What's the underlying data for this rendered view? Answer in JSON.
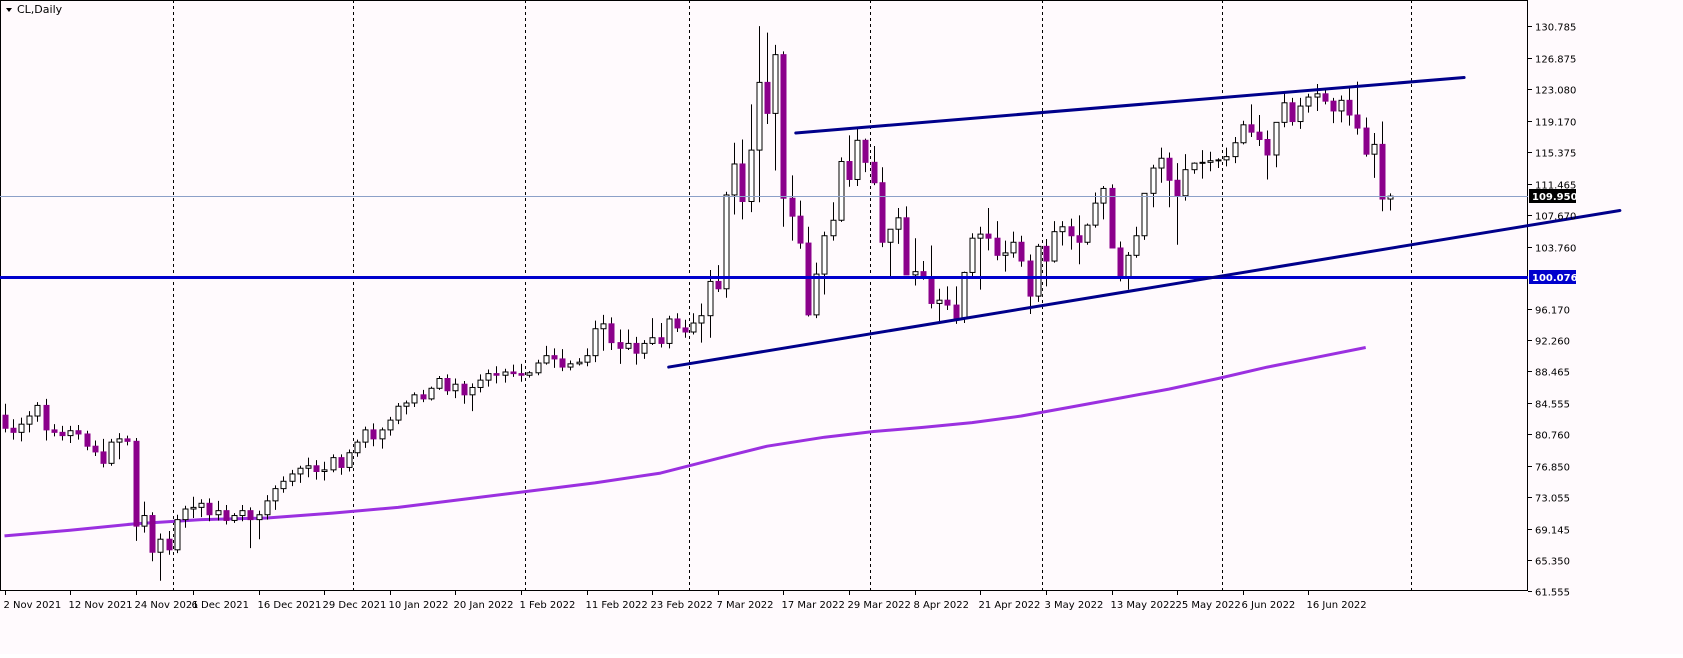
{
  "window": {
    "title": "CL,Daily"
  },
  "colors": {
    "background": "#fffafd",
    "grid": "#000000",
    "bull_body": "#ffffff",
    "bull_border": "#000000",
    "bear_body": "#8b008b",
    "wick": "#000000",
    "ma_line": "#9b30e0",
    "hline": "#0000cd",
    "channel": "#00008b",
    "price_marker_bg": "#000000",
    "price_marker_fg": "#ffffff",
    "hline_marker_bg": "#0000cd"
  },
  "chart_data": {
    "type": "candlestick",
    "symbol": "CL,Daily",
    "y_axis": {
      "min": 61.55,
      "max": 134.0,
      "ticks": [
        130.785,
        126.875,
        123.08,
        119.17,
        115.375,
        111.465,
        107.67,
        103.76,
        96.17,
        92.26,
        88.465,
        84.555,
        80.76,
        76.85,
        73.055,
        69.145,
        65.35,
        61.555
      ]
    },
    "x_axis": {
      "labels": [
        {
          "text": "2 Nov 2021",
          "index": 0
        },
        {
          "text": "12 Nov 2021",
          "index": 8
        },
        {
          "text": "24 Nov 2021",
          "index": 16
        },
        {
          "text": "6 Dec 2021",
          "index": 23
        },
        {
          "text": "16 Dec 2021",
          "index": 31
        },
        {
          "text": "29 Dec 2021",
          "index": 39
        },
        {
          "text": "10 Jan 2022",
          "index": 47
        },
        {
          "text": "20 Jan 2022",
          "index": 55
        },
        {
          "text": "1 Feb 2022",
          "index": 63
        },
        {
          "text": "11 Feb 2022",
          "index": 71
        },
        {
          "text": "23 Feb 2022",
          "index": 79
        },
        {
          "text": "7 Mar 2022",
          "index": 87
        },
        {
          "text": "17 Mar 2022",
          "index": 95
        },
        {
          "text": "29 Mar 2022",
          "index": 103
        },
        {
          "text": "8 Apr 2022",
          "index": 111
        },
        {
          "text": "21 Apr 2022",
          "index": 119
        },
        {
          "text": "3 May 2022",
          "index": 127
        },
        {
          "text": "13 May 2022",
          "index": 135
        },
        {
          "text": "25 May 2022",
          "index": 143
        },
        {
          "text": "6 Jun 2022",
          "index": 151
        },
        {
          "text": "16 Jun 2022",
          "index": 159
        }
      ],
      "separator_indices": [
        20.5,
        42.5,
        63.5,
        83.5,
        105.5,
        126.5,
        148.5,
        171.5
      ]
    },
    "candles": [
      [
        83.1,
        84.5,
        81.0,
        81.5
      ],
      [
        81.5,
        82.6,
        80.1,
        81.0
      ],
      [
        81.0,
        82.8,
        79.9,
        82.0
      ],
      [
        82.0,
        83.6,
        81.0,
        83.0
      ],
      [
        83.0,
        84.7,
        82.3,
        84.3
      ],
      [
        84.3,
        85.1,
        80.0,
        81.3
      ],
      [
        81.3,
        82.0,
        80.5,
        81.0
      ],
      [
        81.0,
        81.8,
        80.0,
        80.6
      ],
      [
        80.6,
        81.8,
        79.7,
        81.2
      ],
      [
        81.2,
        81.9,
        80.1,
        80.8
      ],
      [
        80.8,
        81.2,
        78.8,
        79.3
      ],
      [
        79.3,
        80.0,
        78.1,
        78.6
      ],
      [
        78.6,
        80.2,
        76.7,
        77.2
      ],
      [
        77.2,
        80.2,
        76.9,
        79.8
      ],
      [
        79.8,
        80.9,
        77.7,
        80.2
      ],
      [
        80.2,
        80.6,
        79.4,
        79.9
      ],
      [
        79.9,
        80.3,
        67.7,
        69.5
      ],
      [
        69.5,
        72.5,
        68.7,
        70.8
      ],
      [
        70.8,
        71.2,
        65.2,
        66.3
      ],
      [
        66.3,
        68.6,
        62.8,
        67.9
      ],
      [
        67.9,
        68.9,
        66.0,
        66.6
      ],
      [
        66.6,
        70.9,
        66.2,
        70.3
      ],
      [
        70.3,
        72.0,
        69.3,
        71.6
      ],
      [
        71.6,
        73.1,
        70.5,
        71.8
      ],
      [
        71.8,
        72.8,
        70.6,
        72.3
      ],
      [
        72.3,
        72.9,
        70.1,
        70.9
      ],
      [
        70.9,
        72.6,
        70.2,
        71.4
      ],
      [
        71.4,
        72.1,
        69.7,
        70.2
      ],
      [
        70.2,
        71.1,
        69.9,
        70.8
      ],
      [
        70.8,
        72.1,
        70.1,
        71.4
      ],
      [
        71.4,
        71.8,
        66.8,
        70.3
      ],
      [
        70.3,
        71.4,
        67.9,
        70.9
      ],
      [
        70.9,
        73.3,
        70.3,
        72.6
      ],
      [
        72.6,
        74.5,
        71.5,
        74.1
      ],
      [
        74.1,
        75.6,
        73.6,
        75.0
      ],
      [
        75.0,
        76.4,
        74.4,
        75.9
      ],
      [
        75.9,
        76.9,
        74.8,
        76.6
      ],
      [
        76.6,
        77.9,
        75.5,
        76.9
      ],
      [
        76.9,
        77.6,
        75.2,
        76.2
      ],
      [
        76.2,
        77.4,
        75.1,
        76.4
      ],
      [
        76.4,
        78.3,
        76.1,
        77.9
      ],
      [
        77.9,
        78.3,
        75.8,
        76.7
      ],
      [
        76.7,
        78.9,
        76.2,
        78.5
      ],
      [
        78.5,
        80.1,
        78.0,
        79.8
      ],
      [
        79.8,
        81.7,
        79.1,
        81.3
      ],
      [
        81.3,
        82.1,
        79.3,
        80.2
      ],
      [
        80.2,
        81.6,
        79.0,
        81.3
      ],
      [
        81.3,
        82.9,
        80.6,
        82.5
      ],
      [
        82.5,
        84.6,
        82.0,
        84.2
      ],
      [
        84.2,
        84.9,
        83.2,
        84.6
      ],
      [
        84.6,
        85.9,
        84.1,
        85.6
      ],
      [
        85.6,
        86.2,
        84.7,
        85.1
      ],
      [
        85.1,
        86.6,
        84.9,
        86.4
      ],
      [
        86.4,
        87.9,
        86.2,
        87.6
      ],
      [
        87.6,
        88.1,
        85.6,
        86.1
      ],
      [
        86.1,
        87.6,
        85.2,
        86.9
      ],
      [
        86.9,
        87.3,
        84.5,
        85.6
      ],
      [
        85.6,
        87.0,
        83.6,
        86.5
      ],
      [
        86.5,
        88.1,
        85.9,
        87.4
      ],
      [
        87.4,
        88.7,
        86.6,
        88.2
      ],
      [
        88.2,
        89.1,
        87.0,
        88.0
      ],
      [
        88.0,
        88.8,
        87.1,
        88.4
      ],
      [
        88.4,
        89.3,
        87.8,
        88.2
      ],
      [
        88.2,
        89.4,
        87.2,
        88.0
      ],
      [
        88.0,
        88.5,
        87.7,
        88.3
      ],
      [
        88.3,
        89.9,
        88.0,
        89.5
      ],
      [
        89.5,
        91.6,
        89.3,
        90.4
      ],
      [
        90.4,
        91.3,
        88.9,
        90.0
      ],
      [
        90.0,
        91.2,
        88.5,
        89.0
      ],
      [
        89.0,
        89.8,
        88.6,
        89.4
      ],
      [
        89.4,
        90.1,
        89.2,
        89.6
      ],
      [
        89.6,
        91.3,
        89.1,
        90.4
      ],
      [
        90.4,
        94.7,
        89.6,
        93.7
      ],
      [
        93.7,
        95.4,
        91.0,
        94.3
      ],
      [
        94.3,
        95.1,
        91.1,
        92.0
      ],
      [
        92.0,
        93.6,
        89.4,
        91.3
      ],
      [
        91.3,
        93.6,
        91.1,
        91.9
      ],
      [
        91.9,
        92.7,
        89.3,
        90.7
      ],
      [
        90.7,
        92.3,
        90.0,
        91.9
      ],
      [
        91.9,
        95.0,
        91.7,
        92.6
      ],
      [
        92.6,
        94.4,
        91.4,
        91.9
      ],
      [
        91.9,
        95.3,
        91.3,
        94.9
      ],
      [
        94.9,
        95.6,
        93.3,
        93.8
      ],
      [
        93.8,
        94.8,
        92.6,
        93.3
      ],
      [
        93.3,
        95.6,
        93.0,
        94.4
      ],
      [
        94.4,
        96.8,
        92.0,
        95.3
      ],
      [
        95.3,
        100.9,
        92.6,
        99.5
      ],
      [
        99.5,
        101.5,
        98.2,
        98.6
      ],
      [
        98.6,
        110.5,
        97.5,
        110.1
      ],
      [
        110.1,
        116.5,
        107.7,
        113.9
      ],
      [
        113.9,
        116.9,
        107.1,
        109.3
      ],
      [
        109.3,
        121.2,
        108.0,
        115.6
      ],
      [
        115.6,
        130.8,
        109.2,
        123.9
      ],
      [
        123.9,
        130.0,
        118.8,
        120.1
      ],
      [
        120.1,
        128.5,
        113.1,
        127.3
      ],
      [
        127.3,
        127.7,
        106.2,
        109.7
      ],
      [
        109.7,
        112.5,
        104.5,
        107.5
      ],
      [
        107.5,
        109.4,
        103.5,
        104.2
      ],
      [
        104.2,
        106.2,
        95.2,
        95.4
      ],
      [
        95.4,
        101.8,
        95.0,
        100.4
      ],
      [
        100.4,
        105.6,
        97.9,
        105.1
      ],
      [
        105.1,
        109.2,
        104.5,
        107.0
      ],
      [
        107.0,
        114.7,
        106.8,
        114.2
      ],
      [
        114.2,
        117.4,
        111.1,
        112.0
      ],
      [
        112.0,
        118.3,
        111.2,
        116.8
      ],
      [
        116.8,
        117.0,
        112.9,
        114.1
      ],
      [
        114.1,
        116.1,
        111.3,
        111.6
      ],
      [
        111.6,
        113.5,
        103.7,
        104.3
      ],
      [
        104.3,
        105.8,
        99.8,
        105.9
      ],
      [
        105.9,
        108.5,
        104.1,
        107.3
      ],
      [
        107.3,
        108.7,
        100.9,
        100.3
      ],
      [
        100.3,
        104.8,
        99.0,
        100.7
      ],
      [
        100.7,
        102.0,
        99.7,
        99.9
      ],
      [
        99.9,
        103.9,
        96.2,
        96.8
      ],
      [
        96.8,
        98.6,
        94.5,
        97.2
      ],
      [
        97.2,
        98.9,
        96.0,
        96.6
      ],
      [
        96.6,
        98.9,
        94.3,
        94.9
      ],
      [
        94.9,
        100.7,
        94.4,
        100.6
      ],
      [
        100.6,
        105.4,
        100.1,
        104.8
      ],
      [
        104.8,
        106.2,
        98.5,
        105.3
      ],
      [
        105.3,
        108.5,
        103.3,
        104.8
      ],
      [
        104.8,
        106.9,
        102.1,
        102.7
      ],
      [
        102.7,
        104.5,
        100.7,
        103.0
      ],
      [
        103.0,
        105.6,
        102.4,
        104.3
      ],
      [
        104.3,
        105.1,
        101.3,
        102.0
      ],
      [
        102.0,
        102.8,
        95.5,
        97.7
      ],
      [
        97.7,
        104.1,
        97.0,
        103.8
      ],
      [
        103.8,
        104.7,
        98.9,
        102.0
      ],
      [
        102.0,
        106.9,
        101.8,
        105.6
      ],
      [
        105.6,
        106.9,
        103.9,
        106.2
      ],
      [
        106.2,
        107.2,
        103.4,
        105.1
      ],
      [
        105.1,
        107.6,
        101.6,
        104.3
      ],
      [
        104.3,
        106.6,
        104.0,
        106.4
      ],
      [
        106.4,
        110.4,
        106.1,
        109.1
      ],
      [
        109.1,
        111.2,
        107.1,
        110.9
      ],
      [
        110.9,
        111.4,
        104.4,
        103.6
      ],
      [
        103.6,
        104.4,
        99.5,
        99.9
      ],
      [
        99.9,
        103.1,
        98.5,
        102.7
      ],
      [
        102.7,
        106.2,
        102.4,
        105.1
      ],
      [
        105.1,
        110.2,
        104.6,
        110.3
      ],
      [
        110.3,
        113.8,
        108.6,
        113.4
      ],
      [
        113.4,
        115.9,
        111.6,
        114.6
      ],
      [
        114.6,
        115.3,
        108.6,
        111.9
      ],
      [
        111.9,
        114.0,
        104.0,
        110.0
      ],
      [
        110.0,
        115.1,
        109.4,
        113.2
      ],
      [
        113.2,
        114.1,
        112.7,
        114.0
      ],
      [
        114.0,
        115.6,
        112.1,
        114.1
      ],
      [
        114.1,
        115.4,
        113.0,
        114.3
      ],
      [
        114.3,
        114.6,
        113.4,
        114.4
      ],
      [
        114.4,
        115.9,
        113.6,
        114.8
      ],
      [
        114.8,
        117.2,
        114.0,
        116.5
      ],
      [
        116.5,
        119.2,
        116.3,
        118.7
      ],
      [
        118.7,
        121.2,
        117.2,
        117.8
      ],
      [
        117.8,
        119.9,
        116.1,
        116.9
      ],
      [
        116.9,
        118.0,
        112.0,
        115.0
      ],
      [
        115.0,
        117.5,
        113.5,
        119.0
      ],
      [
        119.0,
        122.7,
        118.4,
        121.4
      ],
      [
        121.4,
        122.0,
        118.6,
        119.1
      ],
      [
        119.1,
        122.0,
        118.2,
        121.0
      ],
      [
        121.0,
        122.5,
        120.2,
        122.1
      ],
      [
        122.1,
        123.7,
        120.4,
        122.5
      ],
      [
        122.5,
        123.1,
        121.2,
        121.6
      ],
      [
        121.6,
        122.0,
        118.9,
        120.4
      ],
      [
        120.4,
        122.3,
        119.0,
        121.7
      ],
      [
        121.7,
        123.5,
        118.6,
        119.9
      ],
      [
        119.9,
        124.0,
        117.5,
        118.3
      ],
      [
        118.3,
        119.6,
        114.8,
        115.1
      ],
      [
        115.1,
        117.7,
        112.2,
        116.3
      ],
      [
        116.3,
        119.1,
        108.1,
        109.6
      ],
      [
        109.6,
        110.3,
        108.2,
        109.95
      ]
    ],
    "moving_average": {
      "label": "",
      "points": [
        [
          0,
          68.3
        ],
        [
          8,
          69.0
        ],
        [
          16,
          69.8
        ],
        [
          24,
          70.3
        ],
        [
          32,
          70.5
        ],
        [
          40,
          71.1
        ],
        [
          48,
          71.8
        ],
        [
          56,
          72.8
        ],
        [
          64,
          73.8
        ],
        [
          72,
          74.8
        ],
        [
          80,
          76.0
        ],
        [
          87,
          77.8
        ],
        [
          93,
          79.3
        ],
        [
          100,
          80.4
        ],
        [
          106,
          81.1
        ],
        [
          112,
          81.6
        ],
        [
          118,
          82.2
        ],
        [
          124,
          83.0
        ],
        [
          130,
          84.1
        ],
        [
          136,
          85.2
        ],
        [
          142,
          86.3
        ],
        [
          148,
          87.6
        ],
        [
          154,
          89.0
        ],
        [
          160,
          90.2
        ],
        [
          166,
          91.4
        ]
      ]
    },
    "horizontal_lines": [
      {
        "price": 100.076,
        "label": "100.076",
        "style": "support"
      },
      {
        "price": 109.95,
        "label": "109.950",
        "style": "current"
      }
    ],
    "trend_lines": [
      {
        "name": "",
        "from": [
          96.5,
          117.7
        ],
        "to": [
          178,
          124.5
        ]
      },
      {
        "name": "",
        "from": [
          81,
          89.0
        ],
        "to": [
          197,
          108.2
        ]
      },
      {
        "name": "",
        "from": [
          96.5,
          117.7
        ],
        "to": [
          96.5,
          117.7
        ]
      }
    ]
  }
}
